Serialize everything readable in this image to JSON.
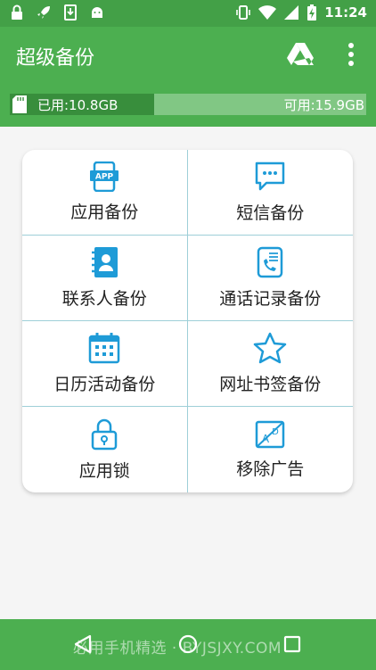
{
  "status_bar": {
    "time": "11:24",
    "left_icons": [
      "lock-icon",
      "rocket-icon",
      "download-icon",
      "android-icon"
    ],
    "right_icons": [
      "vibrate-icon",
      "wifi-icon",
      "signal-icon",
      "battery-charging-icon"
    ]
  },
  "app_bar": {
    "title": "超级备份",
    "icons": [
      "google-drive-icon",
      "more-vert-icon"
    ]
  },
  "storage": {
    "used_label": "已用:10.8GB",
    "free_label": "可用:15.9GB",
    "used_fraction": 0.405
  },
  "grid": [
    {
      "label": "应用备份",
      "icon": "app-icon"
    },
    {
      "label": "短信备份",
      "icon": "sms-icon"
    },
    {
      "label": "联系人备份",
      "icon": "contacts-icon"
    },
    {
      "label": "通话记录备份",
      "icon": "call-log-icon"
    },
    {
      "label": "日历活动备份",
      "icon": "calendar-icon"
    },
    {
      "label": "网址书签备份",
      "icon": "star-icon"
    },
    {
      "label": "应用锁",
      "icon": "lock-icon"
    },
    {
      "label": "移除广告",
      "icon": "remove-ads-icon"
    }
  ],
  "nav_bar": {
    "watermark": "必用手机精选 · BYJSJXY.COM",
    "icons": [
      "back-icon",
      "home-icon",
      "recents-icon"
    ]
  },
  "colors": {
    "primary": "#4caf50",
    "status": "#43a047",
    "bar_used": "#388e3c",
    "bar_free": "#81c784",
    "icon": "#1e9bd7"
  }
}
